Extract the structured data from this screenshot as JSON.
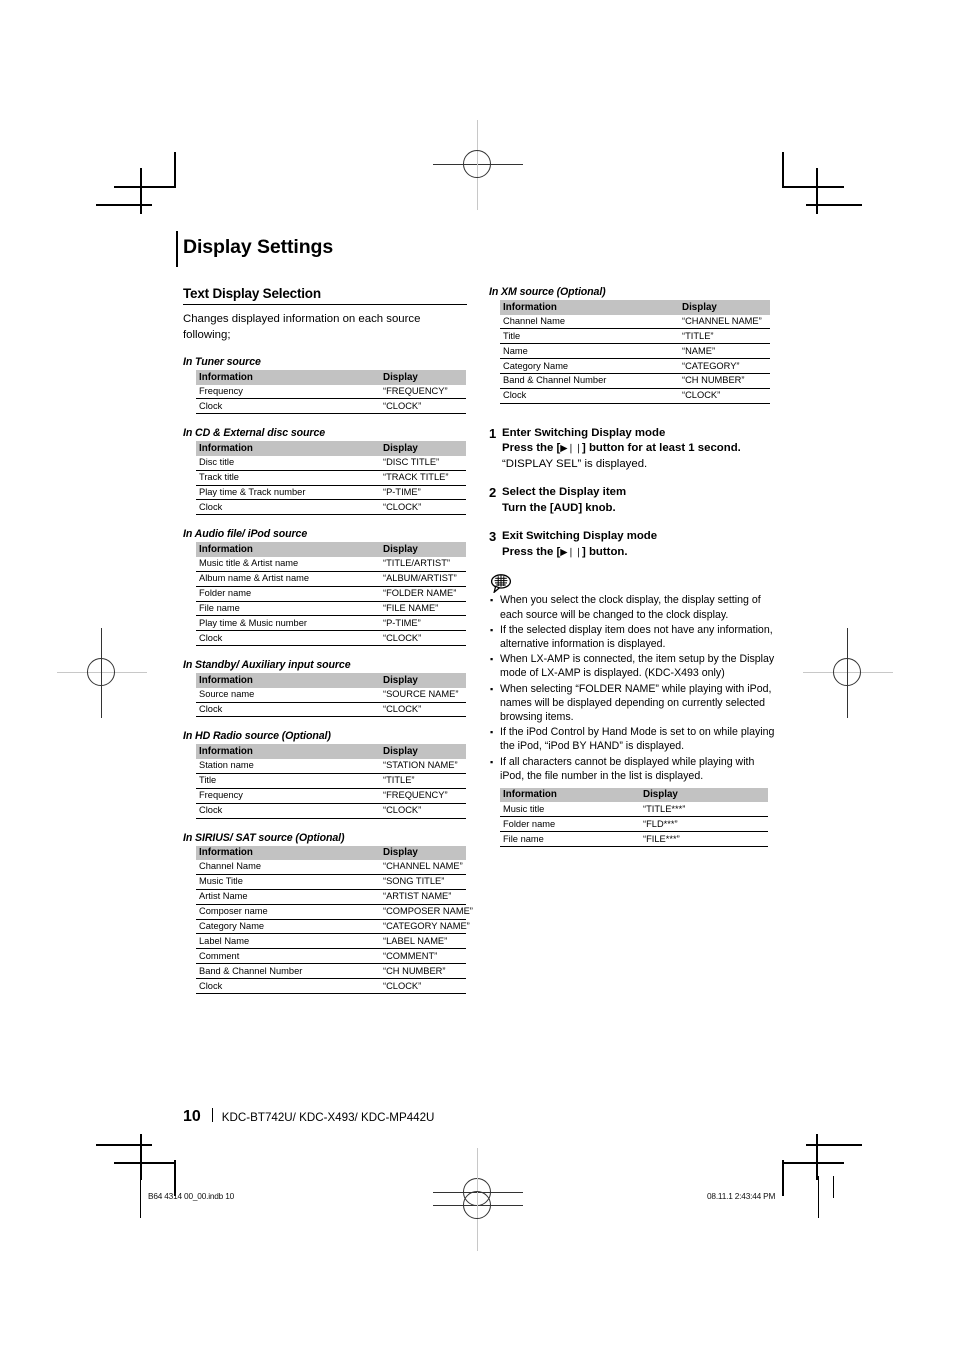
{
  "page": {
    "chapter_title": "Display Settings",
    "section_title": "Text Display Selection",
    "intro": "Changes displayed information on each source following;",
    "page_number": "10",
    "models": "KDC-BT742U/ KDC-X493/ KDC-MP442U",
    "imprint_file": "B64 4314 00_00.indb   10",
    "imprint_stamp": "08.11.1   2:43:44 PM"
  },
  "table_headers": {
    "information": "Information",
    "display": "Display"
  },
  "tables": {
    "tuner": {
      "label": "In Tuner source",
      "rows": [
        {
          "information": "Frequency",
          "display": "“FREQUENCY”"
        },
        {
          "information": "Clock",
          "display": "“CLOCK”"
        }
      ]
    },
    "cd_external": {
      "label": "In CD & External disc source",
      "rows": [
        {
          "information": "Disc title",
          "display": "“DISC TITLE”"
        },
        {
          "information": "Track title",
          "display": "“TRACK TITLE”"
        },
        {
          "information": "Play time & Track number",
          "display": "“P-TIME”"
        },
        {
          "information": "Clock",
          "display": "“CLOCK”"
        }
      ]
    },
    "audio_ipod": {
      "label": "In Audio file/ iPod source",
      "rows": [
        {
          "information": "Music title & Artist name",
          "display": "“TITLE/ARTIST”"
        },
        {
          "information": "Album name & Artist name",
          "display": "“ALBUM/ARTIST”"
        },
        {
          "information": "Folder name",
          "display": "“FOLDER NAME”"
        },
        {
          "information": "File name",
          "display": "“FILE NAME”"
        },
        {
          "information": "Play time & Music number",
          "display": "“P-TIME”"
        },
        {
          "information": "Clock",
          "display": "“CLOCK”"
        }
      ]
    },
    "standby_aux": {
      "label": "In Standby/ Auxiliary input source",
      "rows": [
        {
          "information": "Source name",
          "display": "“SOURCE NAME”"
        },
        {
          "information": "Clock",
          "display": "“CLOCK”"
        }
      ]
    },
    "hd_radio": {
      "label": "In HD Radio source (Optional)",
      "rows": [
        {
          "information": "Station name",
          "display": "“STATION NAME”"
        },
        {
          "information": "Title",
          "display": "“TITLE”"
        },
        {
          "information": "Frequency",
          "display": "“FREQUENCY”"
        },
        {
          "information": "Clock",
          "display": "“CLOCK”"
        }
      ]
    },
    "sirius_sat": {
      "label": "In SIRIUS/ SAT source (Optional)",
      "rows": [
        {
          "information": "Channel Name",
          "display": "“CHANNEL NAME”"
        },
        {
          "information": "Music Title",
          "display": "“SONG TITLE”"
        },
        {
          "information": "Artist Name",
          "display": "“ARTIST NAME”"
        },
        {
          "information": "Composer name",
          "display": "“COMPOSER NAME”"
        },
        {
          "information": "Category Name",
          "display": "“CATEGORY NAME”"
        },
        {
          "information": "Label Name",
          "display": "“LABEL NAME”"
        },
        {
          "information": "Comment",
          "display": "“COMMENT”"
        },
        {
          "information": "Band & Channel Number",
          "display": "“CH NUMBER”"
        },
        {
          "information": "Clock",
          "display": "“CLOCK”"
        }
      ]
    },
    "xm": {
      "label": "In XM source (Optional)",
      "rows": [
        {
          "information": "Channel Name",
          "display": "“CHANNEL NAME”"
        },
        {
          "information": "Title",
          "display": "“TITLE”"
        },
        {
          "information": "Name",
          "display": "“NAME”"
        },
        {
          "information": "Category Name",
          "display": "“CATEGORY”"
        },
        {
          "information": "Band & Channel Number",
          "display": "“CH NUMBER”"
        },
        {
          "information": "Clock",
          "display": "“CLOCK”"
        }
      ]
    },
    "ipod_partial": {
      "rows": [
        {
          "information": "Music title",
          "display": "“TITLE***”"
        },
        {
          "information": "Folder name",
          "display": "“FLD***”"
        },
        {
          "information": "File name",
          "display": "“FILE***”"
        }
      ]
    }
  },
  "steps": [
    {
      "num": "1",
      "title": "Enter Switching Display mode",
      "sub_pre": "Press the [",
      "sub_btn": "▶❘❘",
      "sub_post": "] button for at least 1 second.",
      "note": "“DISPLAY SEL” is displayed."
    },
    {
      "num": "2",
      "title": "Select the Display item",
      "sub_pre": "Turn the [AUD] knob.",
      "sub_btn": "",
      "sub_post": "",
      "note": ""
    },
    {
      "num": "3",
      "title": "Exit Switching Display mode",
      "sub_pre": "Press the [",
      "sub_btn": "▶❘❘",
      "sub_post": "] button.",
      "note": ""
    }
  ],
  "notes": {
    "icon": "note-bubble-icon",
    "bullet": "▪",
    "items": [
      "When you select the clock display, the display setting of each source will be changed to the clock display.",
      "If the selected display item does not have any information, alternative information is displayed.",
      "When LX-AMP is connected, the item setup by the Display mode of LX-AMP is displayed. (KDC-X493 only)",
      "When selecting “FOLDER NAME” while playing with iPod, names will be displayed depending on currently selected browsing items.",
      "If the iPod Control by Hand Mode is set to on while playing the iPod, “iPod BY HAND” is displayed.",
      "If all characters cannot be displayed while playing with iPod, the file number in the list is displayed."
    ]
  },
  "colors": {
    "table_header_bg": "#c2c2c2",
    "rule": "#000000",
    "text": "#000000"
  }
}
